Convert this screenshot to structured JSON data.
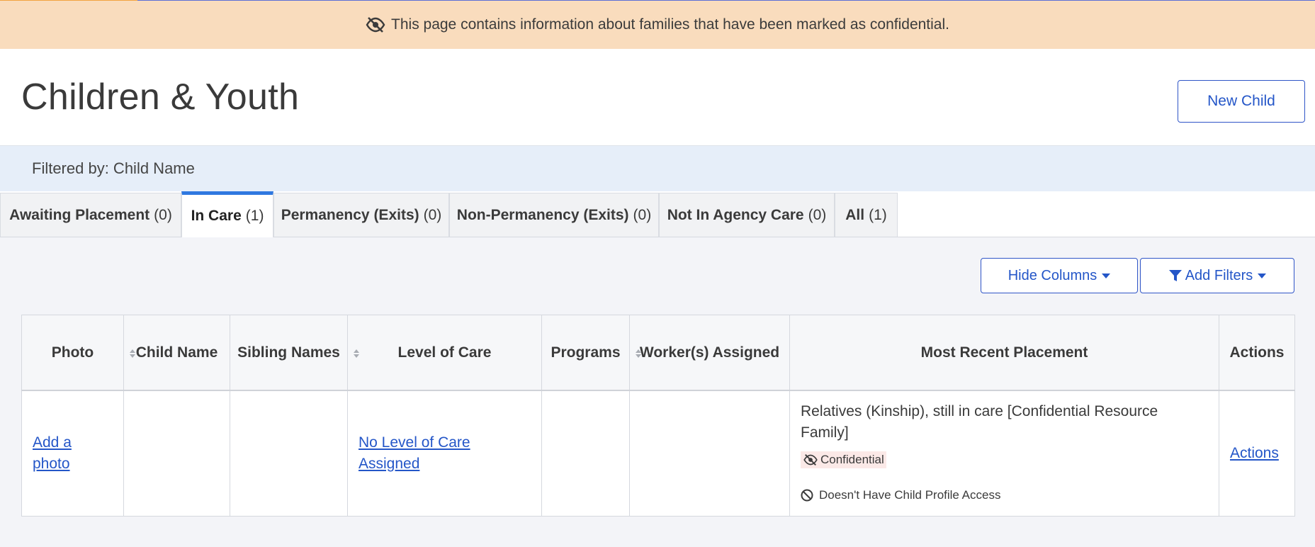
{
  "banner": {
    "text": "This page contains information about families that have been marked as confidential.",
    "icon": "eye-slash-icon"
  },
  "header": {
    "title": "Children & Youth",
    "new_child_label": "New Child"
  },
  "filter": {
    "text": "Filtered by: Child Name"
  },
  "tabs": [
    {
      "label": "Awaiting Placement",
      "count": "(0)"
    },
    {
      "label": "In Care",
      "count": "(1)"
    },
    {
      "label": "Permanency (Exits)",
      "count": "(0)"
    },
    {
      "label": "Non-Permanency (Exits)",
      "count": "(0)"
    },
    {
      "label": "Not In Agency Care",
      "count": "(0)"
    },
    {
      "label": "All",
      "count": "(1)"
    }
  ],
  "active_tab": "In Care",
  "toolbar": {
    "hide_columns_label": "Hide Columns",
    "add_filters_label": "Add Filters"
  },
  "table": {
    "columns": [
      "Photo",
      "Child Name",
      "Sibling Names",
      "Level of Care",
      "Programs",
      "Worker(s) Assigned",
      "Most Recent Placement",
      "Actions"
    ],
    "rows": [
      {
        "photo": "Add a photo",
        "child_name": "",
        "sibling_names": "",
        "level_of_care": "No Level of Care Assigned",
        "programs": "",
        "workers": "",
        "placement": "Relatives (Kinship), still in care [Confidential Resource Family]",
        "confidential_badge": "Confidential",
        "access_note": "Doesn't Have Child Profile Access",
        "actions": "Actions"
      }
    ]
  },
  "colors": {
    "banner_bg": "#f9dcbd",
    "filter_bg": "#e6eef9",
    "link": "#2456c8",
    "active_tab_accent": "#2f78e0"
  }
}
